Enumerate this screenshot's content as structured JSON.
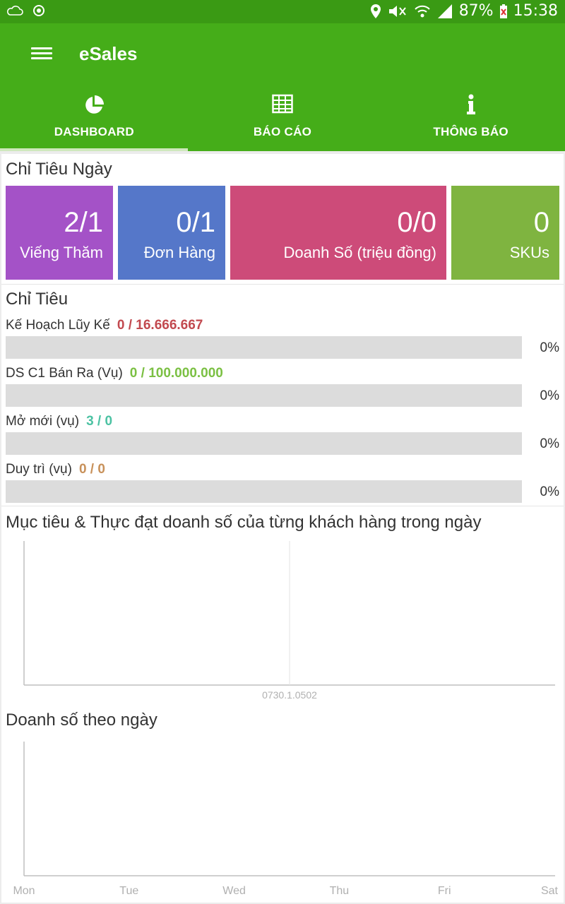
{
  "status_bar": {
    "battery": "87%",
    "time": "15:38"
  },
  "app": {
    "title": "eSales"
  },
  "tabs": [
    {
      "label": "DASHBOARD",
      "icon": "pie-chart-icon",
      "active": true
    },
    {
      "label": "BÁO CÁO",
      "icon": "table-icon",
      "active": false
    },
    {
      "label": "THÔNG BÁO",
      "icon": "info-icon",
      "active": false
    }
  ],
  "daily": {
    "title": "Chỉ Tiêu Ngày",
    "cards": [
      {
        "value": "2/1",
        "label": "Viếng Thăm",
        "color": "#a452c7"
      },
      {
        "value": "0/1",
        "label": "Đơn Hàng",
        "color": "#5577c9"
      },
      {
        "value": "0/0",
        "label": "Doanh Số (triệu đồng)",
        "color": "#cd4b79"
      },
      {
        "value": "0",
        "label": "SKUs",
        "color": "#7fb440"
      }
    ]
  },
  "targets": {
    "title": "Chỉ Tiêu",
    "items": [
      {
        "label": "Kế Hoạch Lũy Kế",
        "value": "0 / 16.666.667",
        "color": "#c2494f",
        "percent": "0%",
        "progress": 0
      },
      {
        "label": "DS C1 Bán Ra (Vụ)",
        "value": "0 / 100.000.000",
        "color": "#7bc043",
        "percent": "0%",
        "progress": 0
      },
      {
        "label": "Mở mới (vụ)",
        "value": "3 / 0",
        "color": "#4cc2a3",
        "percent": "0%",
        "progress": 0
      },
      {
        "label": "Duy trì (vụ)",
        "value": "0 / 0",
        "color": "#c8915a",
        "percent": "0%",
        "progress": 0
      }
    ]
  },
  "chart1": {
    "title": "Mục tiêu & Thực đạt doanh số của từng khách hàng trong ngày",
    "chart_data": {
      "type": "bar",
      "categories": [
        "0730.1.0502"
      ],
      "series": [],
      "grid": false
    }
  },
  "chart2": {
    "title": "Doanh số theo ngày",
    "chart_data": {
      "type": "line",
      "categories": [
        "Mon",
        "Tue",
        "Wed",
        "Thu",
        "Fri",
        "Sat"
      ],
      "series": [],
      "grid": false
    }
  }
}
